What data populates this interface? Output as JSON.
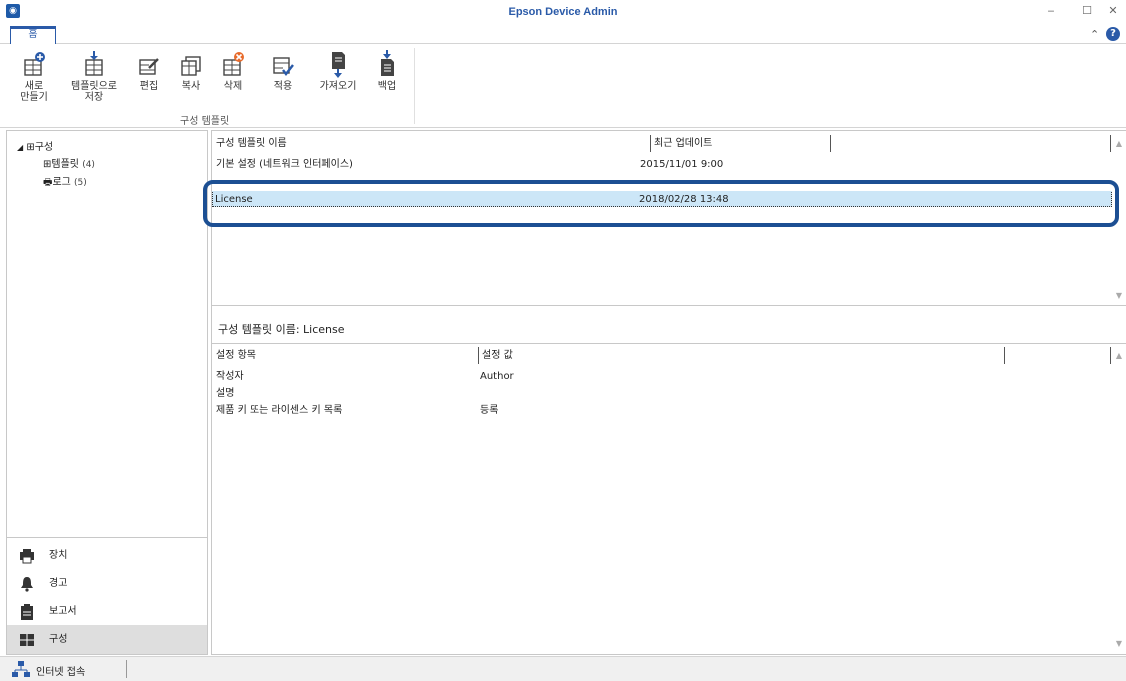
{
  "window": {
    "title": "Epson Device Admin",
    "app_icon": "epson-app-icon"
  },
  "tabs": {
    "home": "홈"
  },
  "ribbon": {
    "buttons": {
      "new": "새로\n만들기",
      "save_template": "템플릿으로\n저장",
      "edit": "편집",
      "copy": "복사",
      "delete": "삭제",
      "apply": "적용",
      "import": "가져오기",
      "backup": "백업"
    },
    "group_label": "구성 템플릿"
  },
  "tree": {
    "root": "구성",
    "templates": {
      "label": "템플릿",
      "count": "(4)"
    },
    "logs": {
      "label": "로그",
      "count": "(5)"
    }
  },
  "nav": {
    "devices": "장치",
    "alerts": "경고",
    "reports": "보고서",
    "config": "구성"
  },
  "template_list": {
    "columns": [
      "구성 템플릿 이름",
      "최근 업데이트"
    ],
    "rows": [
      {
        "name": "기본 설정 (네트워크 인터페이스)",
        "updated": "2015/11/01 9:00"
      },
      {
        "name": "License",
        "updated": "2018/02/28 13:48",
        "selected": true
      }
    ]
  },
  "detail": {
    "title": "구성 템플릿 이름: License",
    "columns": [
      "설정 항목",
      "설정 값"
    ],
    "rows": [
      {
        "item": "작성자",
        "value": "Author"
      },
      {
        "item": "설명",
        "value": ""
      },
      {
        "item": "제품 키 또는 라이센스 키 목록",
        "value": "등록"
      }
    ]
  },
  "status": {
    "internet": "인터넷 접속"
  },
  "colors": {
    "accent": "#2a5aa8",
    "selection": "#cce6f7",
    "highlight_ring": "#1c4f93"
  }
}
